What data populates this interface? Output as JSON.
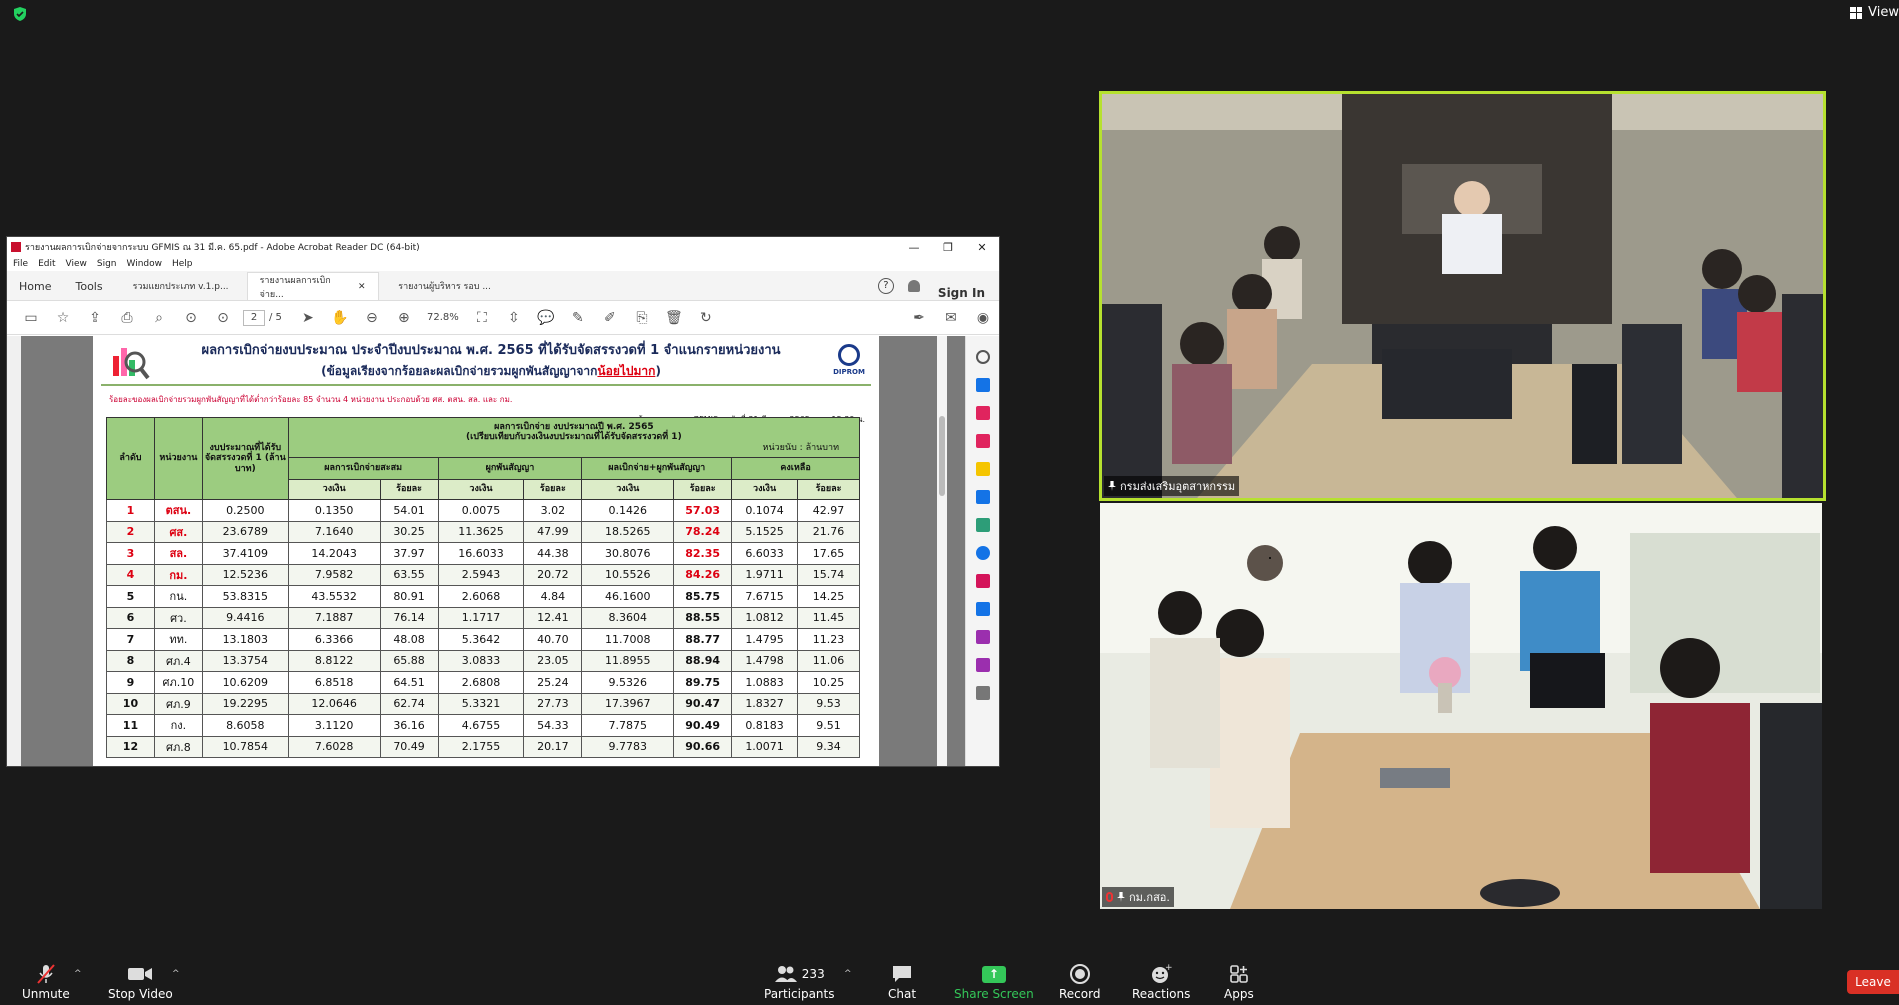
{
  "top_bar": {
    "view_label": "View"
  },
  "acrobat": {
    "window_title": "รายงานผลการเบิกจ่ายจากระบบ GFMIS ณ 31 มี.ค. 65.pdf - Adobe Acrobat Reader DC (64-bit)",
    "menu": [
      "File",
      "Edit",
      "View",
      "Sign",
      "Window",
      "Help"
    ],
    "tabs": {
      "home": "Home",
      "tools": "Tools",
      "doc1": "รวมแยกประเภท v.1.p...",
      "doc2": "รายงานผลการเบิกจ่าย...",
      "doc3": "รายงานผู้บริหาร รอบ ..."
    },
    "sign_in": "Sign In",
    "page_current": "2",
    "page_total": "/ 5",
    "zoom": "72.8%",
    "pdf": {
      "title": "ผลการเบิกจ่ายงบประมาณ ประจำปีงบประมาณ พ.ศ. 2565 ที่ได้รับจัดสรรงวดที่ 1 จำแนกรายหน่วยงาน",
      "subtitle_prefix": "(ข้อมูลเรียงจากร้อยละผลเบิกจ่ายรวมผูกพันสัญญาจาก",
      "subtitle_red": "น้อยไปมาก",
      "subtitle_suffix": ")",
      "logo_text": "DIPROM",
      "note_red": "ร้อยละของผลเบิกจ่ายรวมผูกพันสัญญาที่ได้ต่ำกว่าร้อยละ 85 จำนวน 4 หน่วยงาน ประกอบด้วย ศส. ตสน. สล. และ กม.",
      "note_source": "ข้อมูลจากระบบ GFMIS ณ วันที่ 31 มีนาคม 2565 เวลา 15.39 น.",
      "headers": {
        "no": "ลำดับ",
        "unit": "หน่วยงาน",
        "budget": "งบประมาณที่ได้รับจัดสรรงวดที่ 1 (ล้านบาท)",
        "group": "ผลการเบิกจ่าย งบประมาณปี พ.ศ. 2565",
        "group_sub": "(เปรียบเทียบกับวงเงินงบประมาณที่ได้รับจัดสรรงวดที่ 1)",
        "unit_note": "หน่วยนับ : ล้านบาท",
        "cum": "ผลการเบิกจ่ายสะสม",
        "commit": "ผูกพันสัญญา",
        "total": "ผลเบิกจ่าย+ผูกพันสัญญา",
        "remain": "คงเหลือ",
        "amount": "วงเงิน",
        "pct": "ร้อยละ"
      },
      "rows": [
        {
          "no": "1",
          "unit": "ตสน.",
          "budget": "0.2500",
          "cum_amt": "0.1350",
          "cum_pct": "54.01",
          "com_amt": "0.0075",
          "com_pct": "3.02",
          "tot_amt": "0.1426",
          "tot_pct": "57.03",
          "rem_amt": "0.1074",
          "rem_pct": "42.97"
        },
        {
          "no": "2",
          "unit": "ศส.",
          "budget": "23.6789",
          "cum_amt": "7.1640",
          "cum_pct": "30.25",
          "com_amt": "11.3625",
          "com_pct": "47.99",
          "tot_amt": "18.5265",
          "tot_pct": "78.24",
          "rem_amt": "5.1525",
          "rem_pct": "21.76"
        },
        {
          "no": "3",
          "unit": "สล.",
          "budget": "37.4109",
          "cum_amt": "14.2043",
          "cum_pct": "37.97",
          "com_amt": "16.6033",
          "com_pct": "44.38",
          "tot_amt": "30.8076",
          "tot_pct": "82.35",
          "rem_amt": "6.6033",
          "rem_pct": "17.65"
        },
        {
          "no": "4",
          "unit": "กม.",
          "budget": "12.5236",
          "cum_amt": "7.9582",
          "cum_pct": "63.55",
          "com_amt": "2.5943",
          "com_pct": "20.72",
          "tot_amt": "10.5526",
          "tot_pct": "84.26",
          "rem_amt": "1.9711",
          "rem_pct": "15.74"
        },
        {
          "no": "5",
          "unit": "กน.",
          "budget": "53.8315",
          "cum_amt": "43.5532",
          "cum_pct": "80.91",
          "com_amt": "2.6068",
          "com_pct": "4.84",
          "tot_amt": "46.1600",
          "tot_pct": "85.75",
          "rem_amt": "7.6715",
          "rem_pct": "14.25"
        },
        {
          "no": "6",
          "unit": "ศว.",
          "budget": "9.4416",
          "cum_amt": "7.1887",
          "cum_pct": "76.14",
          "com_amt": "1.1717",
          "com_pct": "12.41",
          "tot_amt": "8.3604",
          "tot_pct": "88.55",
          "rem_amt": "1.0812",
          "rem_pct": "11.45"
        },
        {
          "no": "7",
          "unit": "ทท.",
          "budget": "13.1803",
          "cum_amt": "6.3366",
          "cum_pct": "48.08",
          "com_amt": "5.3642",
          "com_pct": "40.70",
          "tot_amt": "11.7008",
          "tot_pct": "88.77",
          "rem_amt": "1.4795",
          "rem_pct": "11.23"
        },
        {
          "no": "8",
          "unit": "ศภ.4",
          "budget": "13.3754",
          "cum_amt": "8.8122",
          "cum_pct": "65.88",
          "com_amt": "3.0833",
          "com_pct": "23.05",
          "tot_amt": "11.8955",
          "tot_pct": "88.94",
          "rem_amt": "1.4798",
          "rem_pct": "11.06"
        },
        {
          "no": "9",
          "unit": "ศภ.10",
          "budget": "10.6209",
          "cum_amt": "6.8518",
          "cum_pct": "64.51",
          "com_amt": "2.6808",
          "com_pct": "25.24",
          "tot_amt": "9.5326",
          "tot_pct": "89.75",
          "rem_amt": "1.0883",
          "rem_pct": "10.25"
        },
        {
          "no": "10",
          "unit": "ศภ.9",
          "budget": "19.2295",
          "cum_amt": "12.0646",
          "cum_pct": "62.74",
          "com_amt": "5.3321",
          "com_pct": "27.73",
          "tot_amt": "17.3967",
          "tot_pct": "90.47",
          "rem_amt": "1.8327",
          "rem_pct": "9.53"
        },
        {
          "no": "11",
          "unit": "กง.",
          "budget": "8.6058",
          "cum_amt": "3.1120",
          "cum_pct": "36.16",
          "com_amt": "4.6755",
          "com_pct": "54.33",
          "tot_amt": "7.7875",
          "tot_pct": "90.49",
          "rem_amt": "0.8183",
          "rem_pct": "9.51"
        },
        {
          "no": "12",
          "unit": "ศภ.8",
          "budget": "10.7854",
          "cum_amt": "7.6028",
          "cum_pct": "70.49",
          "com_amt": "2.1755",
          "com_pct": "20.17",
          "tot_amt": "9.7783",
          "tot_pct": "90.66",
          "rem_amt": "1.0071",
          "rem_pct": "9.34"
        }
      ]
    }
  },
  "videos": [
    {
      "name": "กรมส่งเสริมอุตสาหกรรม",
      "active_speaker": true
    },
    {
      "name": "กม.กสอ.",
      "muted": true
    }
  ],
  "bottom_bar": {
    "unmute": "Unmute",
    "stop_video": "Stop Video",
    "participants": "Participants",
    "participants_count": "233",
    "chat": "Chat",
    "share_screen": "Share Screen",
    "record": "Record",
    "reactions": "Reactions",
    "apps": "Apps",
    "leave": "Leave"
  },
  "colors": {
    "active_speaker_border": "#b6e12f",
    "share_green": "#34c759",
    "leave_red": "#d93025",
    "table_header_green": "#9ccc80"
  }
}
